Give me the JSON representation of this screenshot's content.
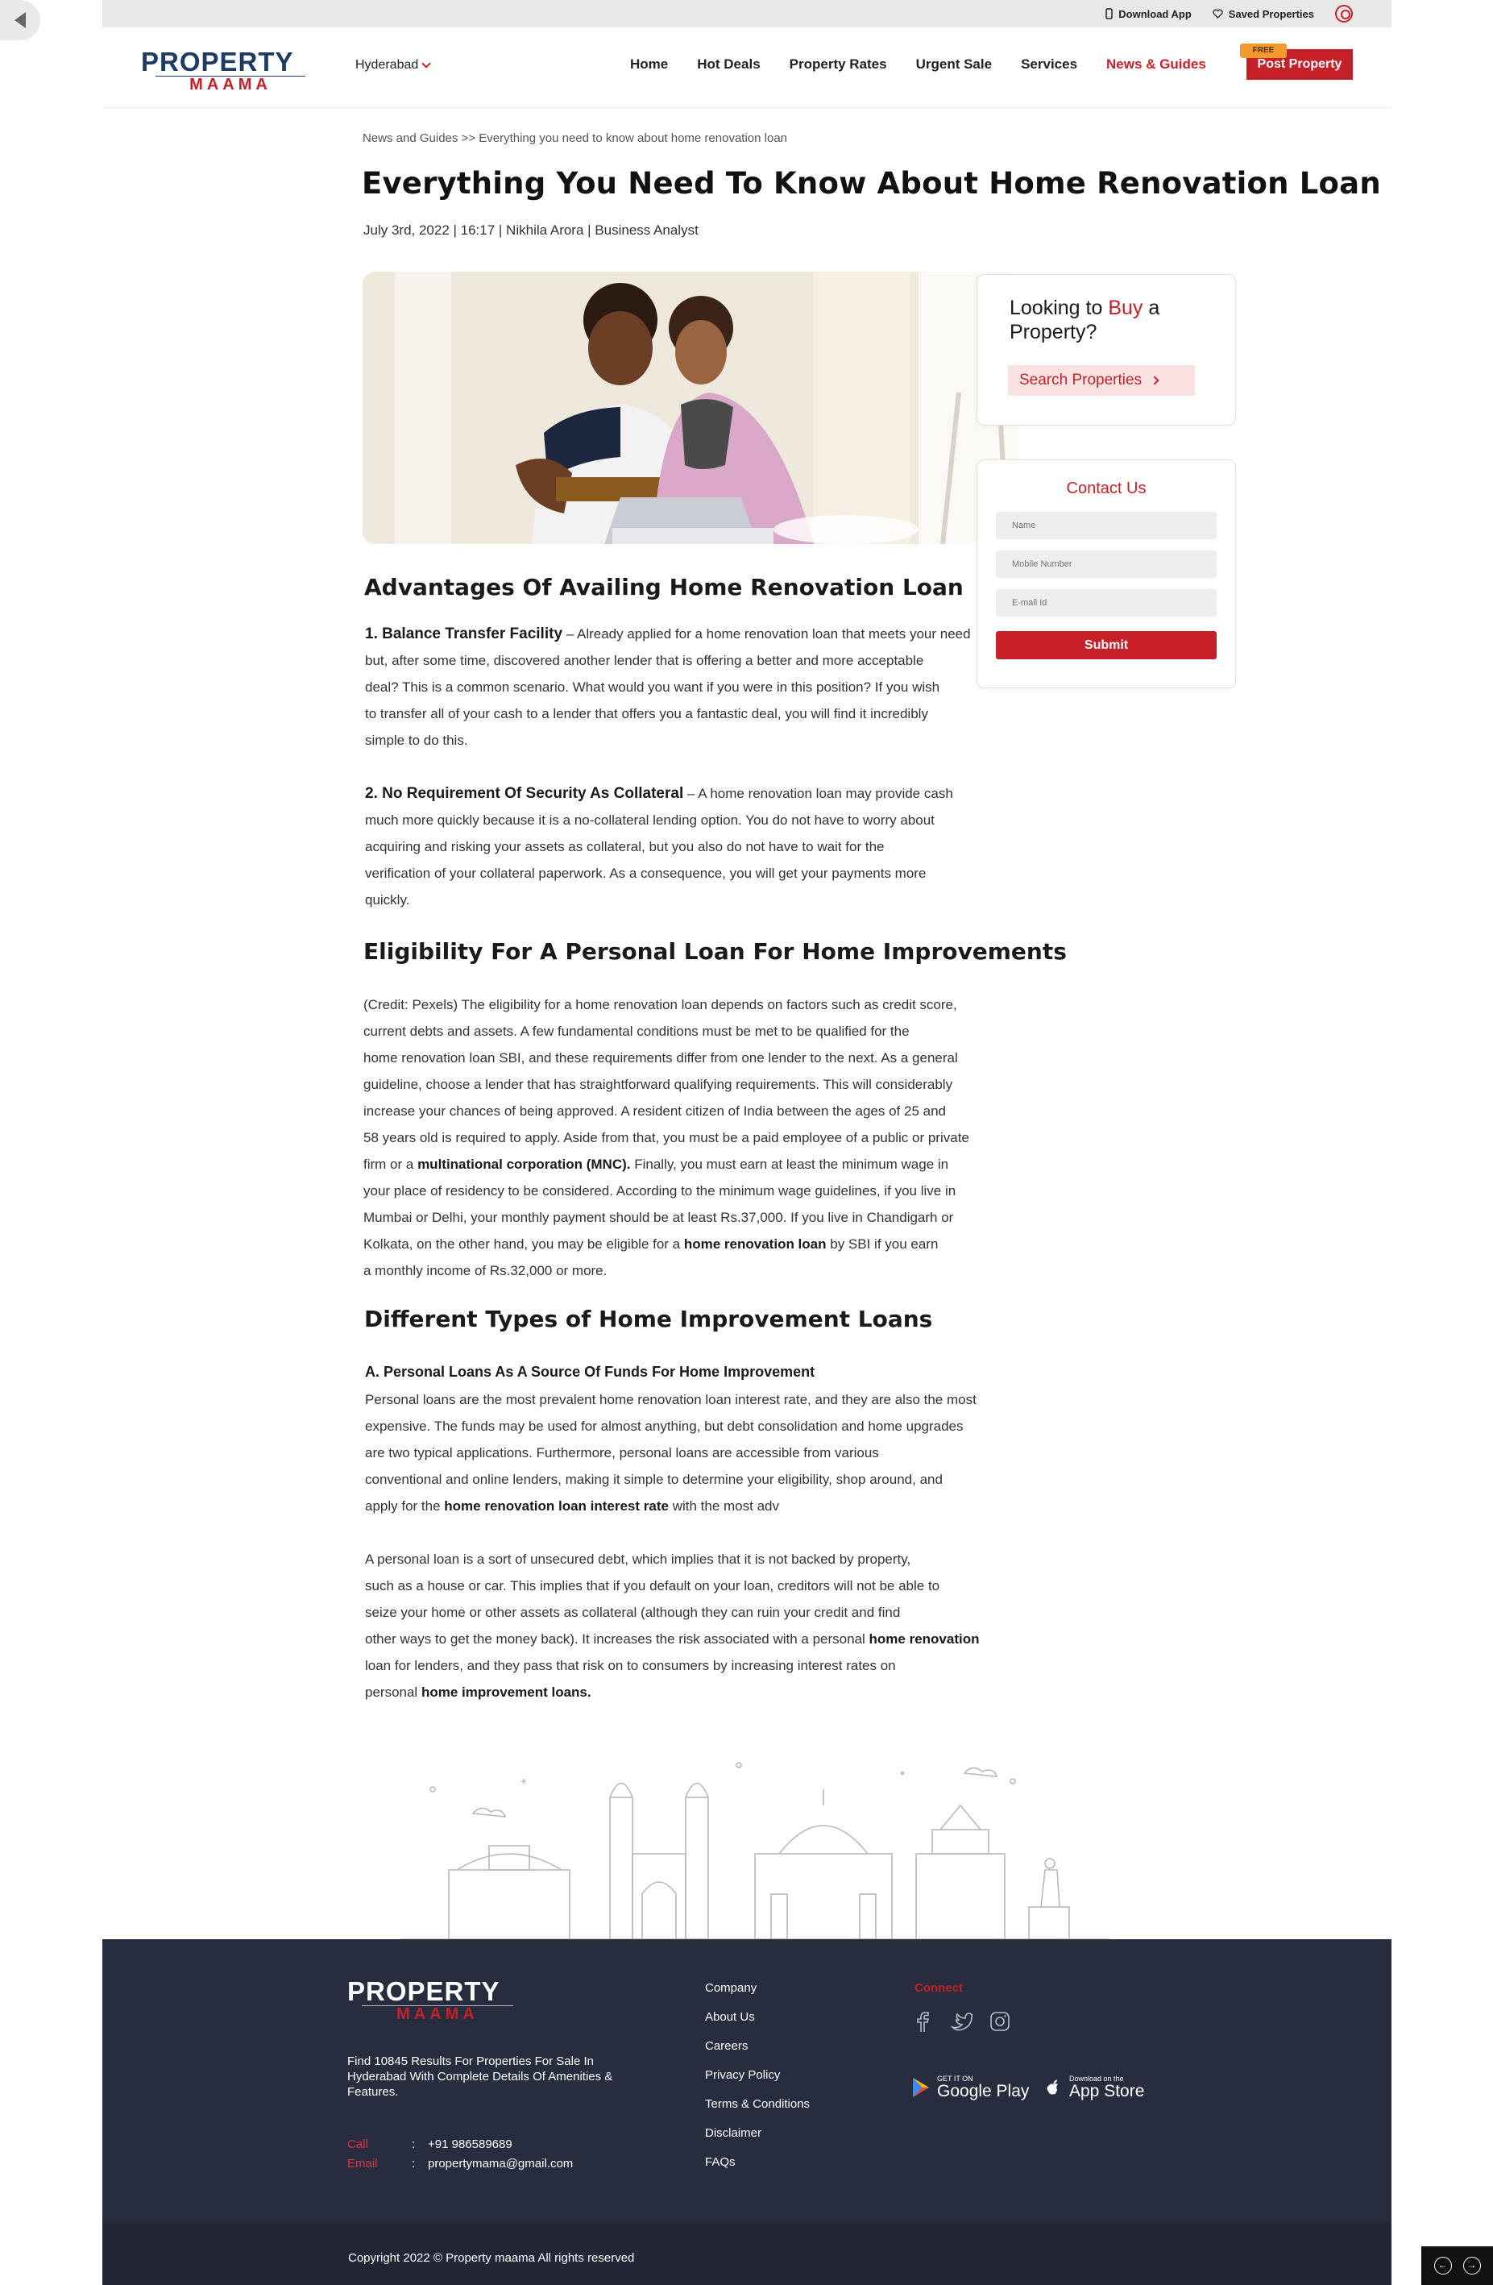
{
  "topbar": {
    "download_app": "Download App",
    "saved_properties": "Saved Properties"
  },
  "header": {
    "logo_top": "PROPERTY",
    "logo_bottom": "MAAMA",
    "city": "Hyderabad",
    "nav": [
      "Home",
      "Hot Deals",
      "Property Rates",
      "Urgent Sale",
      "Services",
      "News & Guides"
    ],
    "free_tag": "FREE",
    "post_property": "Post Property"
  },
  "article": {
    "breadcrumb": "News and Guides >> Everything you need to know about home renovation loan",
    "title": "Everything You Need To Know About Home Renovation Loan",
    "meta": "July 3rd, 2022 | 16:17 | Nikhila Arora | Business Analyst",
    "h_advantages": "Advantages Of Availing Home Renovation Loan",
    "adv1_lead": "1. Balance Transfer Facility",
    "adv1_lines": [
      " – Already applied for a home renovation loan that meets your need",
      "but, after some time, discovered another lender that is offering a better and more acceptable",
      "deal? This is a common scenario. What would you want if you were in this position? If you wish",
      "to transfer all of your cash to a lender that offers you a fantastic deal, you will find it incredibly",
      "simple to do this."
    ],
    "adv2_lead": "2. No Requirement Of Security As Collateral",
    "adv2_lines": [
      " – A home renovation loan may provide cash",
      "much more quickly because it is a no-collateral lending option. You do not have to worry about",
      "acquiring and risking your assets as collateral, but you also do not have to wait for the",
      "verification of your collateral paperwork. As a consequence, you will get your payments more",
      "quickly."
    ],
    "h_eligibility": "Eligibility For A Personal Loan For Home Improvements",
    "elig_lines": [
      "(Credit: Pexels) The eligibility for a home renovation loan depends on factors such as credit score,",
      "current debts and assets. A few fundamental conditions must be met to be qualified for the",
      "home renovation loan SBI, and these requirements differ from one lender to the next. As a general",
      "guideline, choose a lender that has straightforward qualifying requirements. This will considerably",
      "increase your chances of being approved. A resident citizen of India between the ages of 25 and",
      "58 years old is required to apply. Aside from that, you must be a paid employee of a public or private"
    ],
    "elig_l7_pre": "firm or a ",
    "elig_l7_bold": "multinational corporation (MNC).",
    "elig_l7_post": " Finally, you must earn at least the minimum wage in",
    "elig_l8": "your place of residency to be considered.  According to the minimum wage guidelines, if you live in",
    "elig_l9": "Mumbai or Delhi, your monthly payment should be at least Rs.37,000. If you live in Chandigarh or",
    "elig_l10_pre": "Kolkata, on the other hand, you may be eligible for a ",
    "elig_l10_bold": "home renovation loan",
    "elig_l10_post": " by SBI if you earn",
    "elig_l11": "a monthly income of Rs.32,000 or more.",
    "h_types": "Different Types of Home Improvement Loans",
    "types_sub": "A. Personal Loans As A Source Of Funds For Home Improvement",
    "types_lines": [
      "Personal loans are the most prevalent home renovation loan interest rate, and they are also the most",
      "expensive. The funds may be used for almost anything, but debt consolidation and home upgrades",
      "are two typical applications. Furthermore, personal loans are accessible from various",
      "conventional and online lenders, making it simple to determine your eligibility, shop around, and"
    ],
    "types_l5_pre": " apply for the ",
    "types_l5_bold": "home renovation loan interest rate",
    "types_l5_post": " with the most adv",
    "pl_lines": [
      "A personal loan is a sort of unsecured debt, which implies that it is not backed by property,",
      "such as a house or car. This implies that if you default on your loan, creditors will not be able to",
      "seize your home or other assets as collateral (although they can ruin your credit and find"
    ],
    "pl_l4_pre": "other ways to get the money back). It increases the risk associated with a personal ",
    "pl_l4_bold": "home renovation",
    "pl_l5": "loan for lenders, and they pass that risk on to consumers by increasing interest rates on",
    "pl_l6_pre": " personal ",
    "pl_l6_bold": "home improvement loans."
  },
  "sidebar": {
    "buy_pre": "Looking to ",
    "buy_red": "Buy",
    "buy_post": " a Property?",
    "search_btn": "Search Properties",
    "contact_title": "Contact Us",
    "name_ph": "Name",
    "mobile_ph": "Mobile Number",
    "email_ph": "E-mail Id",
    "submit": "Submit"
  },
  "footer": {
    "logo_top": "PROPERTY",
    "logo_bottom": "MAAMA",
    "description": "Find 10845 Results For Properties For Sale In Hyderabad With Complete Details Of Amenities & Features.",
    "call_label": "Call",
    "call_value": "+91 986589689",
    "email_label": "Email",
    "email_value": "propertymama@gmail.com",
    "links": [
      "Company",
      "About Us",
      "Careers",
      "Privacy Policy",
      "Terms & Conditions",
      "Disclaimer",
      "FAQs"
    ],
    "connect": "Connect",
    "google_small": "GET IT ON",
    "google_big": "Google Play",
    "apple_small": "Download on the",
    "apple_big": "App Store",
    "copyright": "Copyright 2022 © Property maama All rights reserved"
  },
  "colors": {
    "brand_red": "#c62129",
    "brand_navy": "#1d3b63",
    "footer_bg": "#272d3e"
  }
}
